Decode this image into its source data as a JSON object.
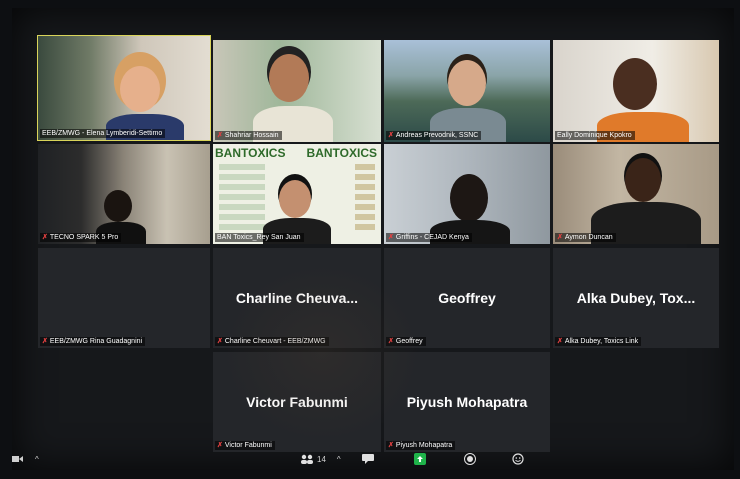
{
  "participants": [
    {
      "name": "EEB/ZMWG - Elena Lymberidi-Settimo",
      "video": true
    },
    {
      "name": "Shahriar Hossain",
      "video": true
    },
    {
      "name": "Andreas Prevodnik, SSNC",
      "video": true
    },
    {
      "name": "Eally Dominique Kpokro",
      "video": true
    },
    {
      "name": "TECNO SPARK 5 Pro",
      "video": true
    },
    {
      "name": "BAN Toxics_Rey San Juan",
      "video": true
    },
    {
      "name": "Griffins - CEJAD Kenya",
      "video": true
    },
    {
      "name": "Aymon Duncan",
      "video": true
    },
    {
      "name": "EEB/ZMWG Rina Guadagnini",
      "video": false,
      "display": ""
    },
    {
      "name": "Charline Cheuvart - EEB/ZMWG",
      "video": false,
      "display": "Charline  Cheuva..."
    },
    {
      "name": "Geoffrey",
      "video": false,
      "display": "Geoffrey"
    },
    {
      "name": "Alka Dubey, Toxics Link",
      "video": false,
      "display": "Alka Dubey,  Tox..."
    },
    {
      "name": "Victor Fabunmi",
      "video": false,
      "display": "Victor Fabunmi"
    },
    {
      "name": "Piyush Mohapatra",
      "video": false,
      "display": "Piyush Mohapatra"
    }
  ],
  "ban_toxics_banner": "BANTOXICS",
  "toolbar": {
    "participants_count": "14",
    "icons": [
      "video-icon",
      "participants-icon",
      "chat-icon",
      "share-screen-icon",
      "record-icon",
      "reactions-icon"
    ]
  }
}
